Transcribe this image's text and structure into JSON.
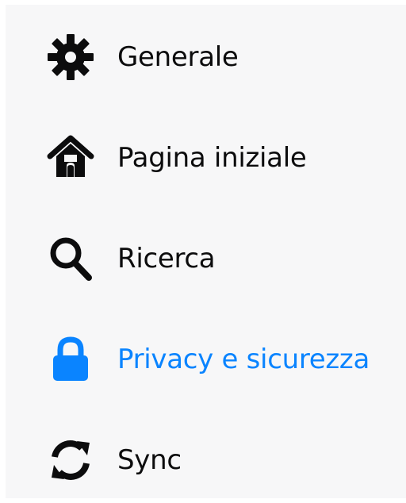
{
  "sidebar": {
    "accent_color": "#0a84ff",
    "text_color": "#0c0c0d",
    "items": [
      {
        "label": "Generale",
        "icon": "gear-icon",
        "selected": false
      },
      {
        "label": "Pagina iniziale",
        "icon": "home-icon",
        "selected": false
      },
      {
        "label": "Ricerca",
        "icon": "search-icon",
        "selected": false
      },
      {
        "label": "Privacy e sicurezza",
        "icon": "lock-icon",
        "selected": true
      },
      {
        "label": "Sync",
        "icon": "sync-icon",
        "selected": false
      }
    ]
  }
}
